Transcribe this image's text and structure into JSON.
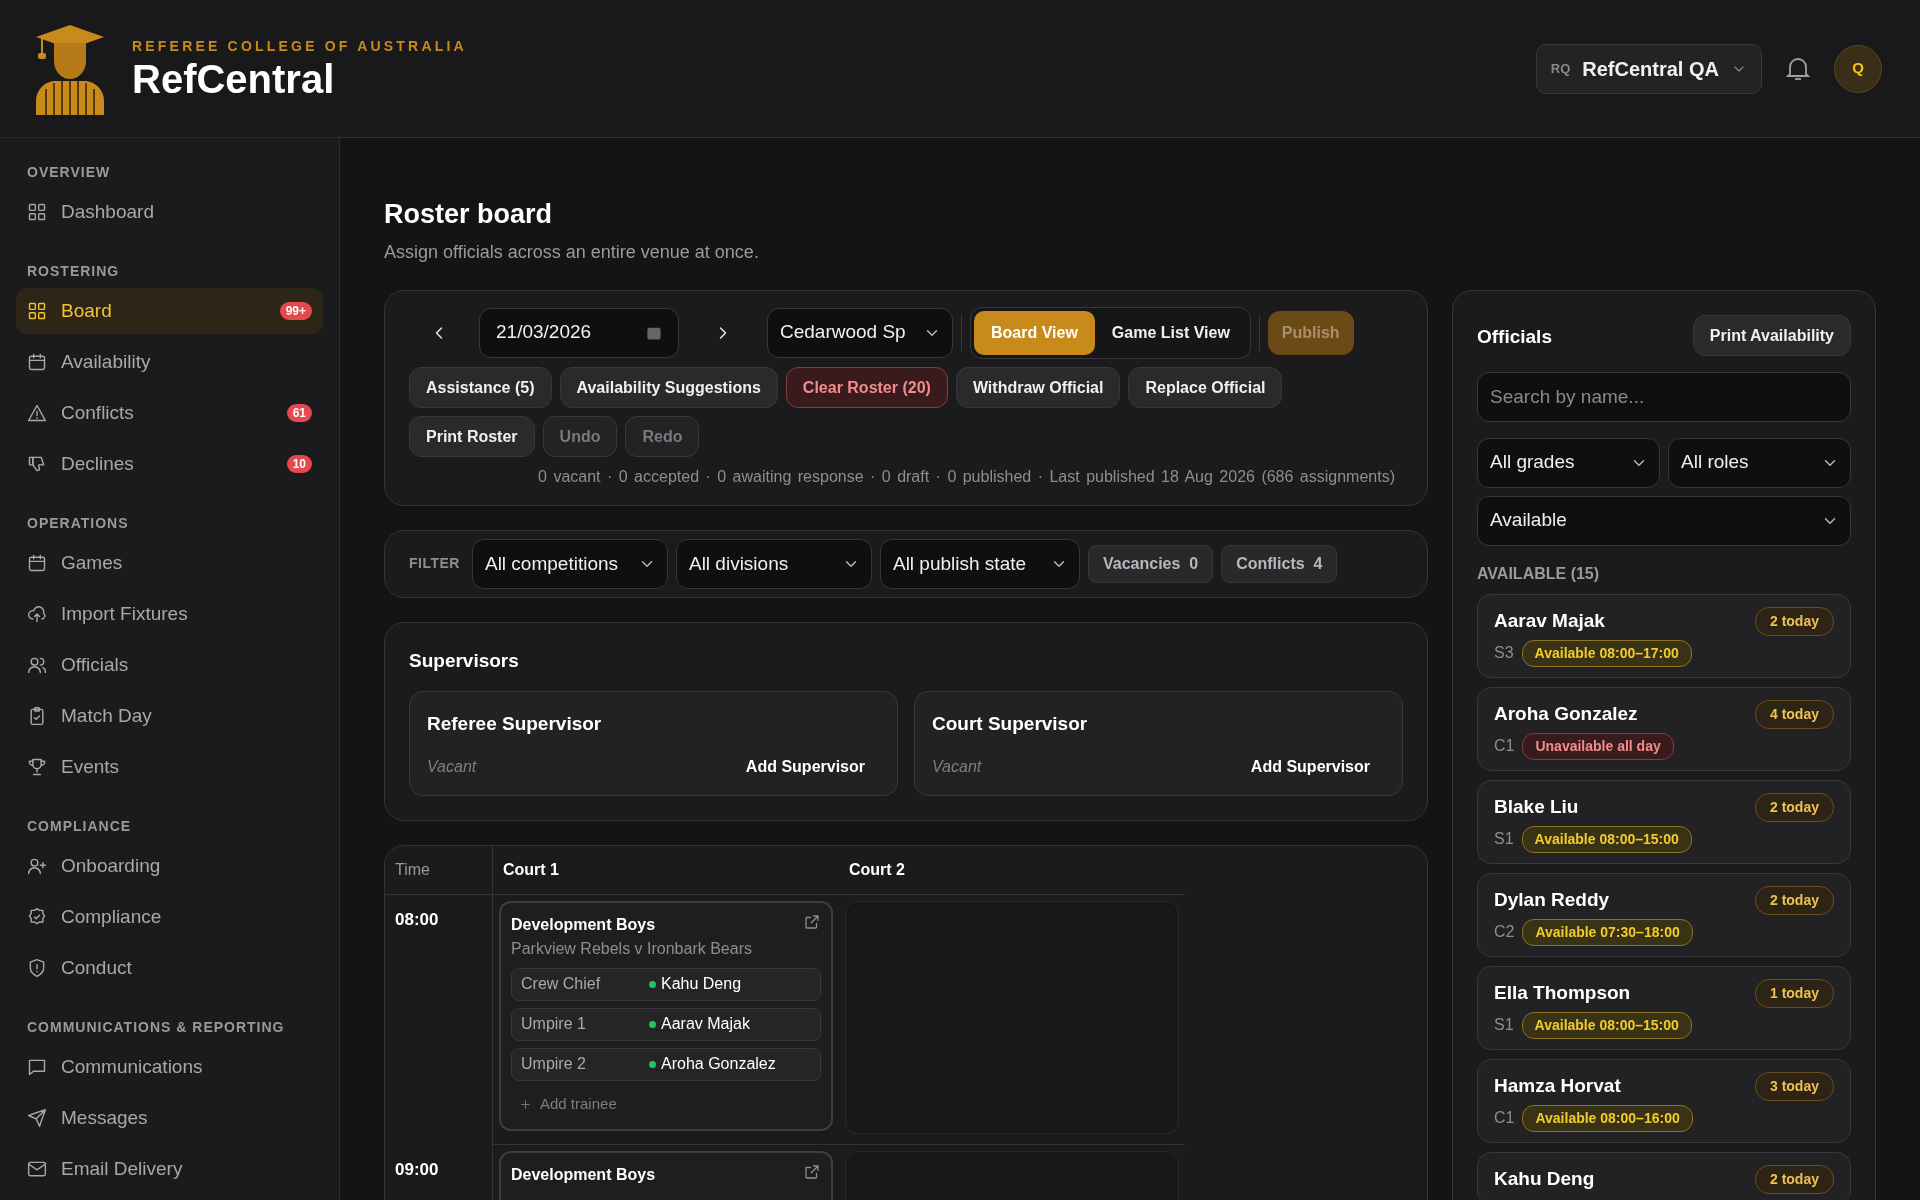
{
  "header": {
    "org": "REFEREE COLLEGE OF AUSTRALIA",
    "app": "RefCentral",
    "workspace": {
      "initials": "RQ",
      "name": "RefCentral QA"
    },
    "avatar": "Q"
  },
  "sidebar": {
    "sections": [
      {
        "title": "OVERVIEW",
        "items": [
          {
            "label": "Dashboard",
            "selected": false
          }
        ]
      },
      {
        "title": "ROSTERING",
        "items": [
          {
            "label": "Board",
            "selected": true,
            "badge": "99+"
          },
          {
            "label": "Availability",
            "selected": false
          },
          {
            "label": "Conflicts",
            "selected": false,
            "badge": "61"
          },
          {
            "label": "Declines",
            "selected": false,
            "badge": "10"
          }
        ]
      },
      {
        "title": "OPERATIONS",
        "items": [
          {
            "label": "Games",
            "selected": false
          },
          {
            "label": "Import Fixtures",
            "selected": false
          },
          {
            "label": "Officials",
            "selected": false
          },
          {
            "label": "Match Day",
            "selected": false
          },
          {
            "label": "Events",
            "selected": false
          }
        ]
      },
      {
        "title": "COMPLIANCE",
        "items": [
          {
            "label": "Onboarding",
            "selected": false
          },
          {
            "label": "Compliance",
            "selected": false
          },
          {
            "label": "Conduct",
            "selected": false
          }
        ]
      },
      {
        "title": "COMMUNICATIONS & REPORTING",
        "items": [
          {
            "label": "Communications",
            "selected": false
          },
          {
            "label": "Messages",
            "selected": false
          },
          {
            "label": "Email Delivery",
            "selected": false
          }
        ]
      }
    ]
  },
  "page": {
    "title": "Roster board",
    "subtitle": "Assign officials across an entire venue at once."
  },
  "toolbar": {
    "date": "21/03/2026",
    "venue": "Cedarwood Sp",
    "views": [
      {
        "label": "Board View",
        "selected": true
      },
      {
        "label": "Game List View",
        "selected": false
      }
    ],
    "publish": {
      "label": "Publish",
      "disabled": true
    },
    "actions": [
      {
        "label": "Assistance (5)",
        "kind": "default"
      },
      {
        "label": "Availability Suggestions",
        "kind": "default"
      },
      {
        "label": "Clear Roster (20)",
        "kind": "danger"
      },
      {
        "label": "Withdraw Official",
        "kind": "default"
      },
      {
        "label": "Replace Official",
        "kind": "default"
      },
      {
        "label": "Print Roster",
        "kind": "default"
      },
      {
        "label": "Undo",
        "kind": "disabled"
      },
      {
        "label": "Redo",
        "kind": "disabled"
      }
    ],
    "summary": "0 vacant · 0 accepted · 0 awaiting response · 0 draft · 0 published · Last published 18 Aug 2026 (686 assignments)"
  },
  "filter": {
    "label": "FILTER",
    "selects": [
      "All competitions",
      "All divisions",
      "All publish state"
    ],
    "chips": [
      {
        "label": "Vacancies",
        "count": "0"
      },
      {
        "label": "Conflicts",
        "count": "4"
      }
    ]
  },
  "supervisors": {
    "title": "Supervisors",
    "cards": [
      {
        "role": "Referee Supervisor",
        "status": "Vacant",
        "action": "Add Supervisor"
      },
      {
        "role": "Court Supervisor",
        "status": "Vacant",
        "action": "Add Supervisor"
      }
    ]
  },
  "board": {
    "columns": [
      "Time",
      "Court 1",
      "Court 2"
    ],
    "slots": [
      {
        "time": "08:00",
        "games": [
          {
            "division": "Development Boys",
            "teams": "Parkview Rebels v Ironbark Bears",
            "roles": [
              {
                "role": "Crew Chief",
                "official": "Kahu Deng",
                "color": "#22c55e"
              },
              {
                "role": "Umpire 1",
                "official": "Aarav Majak",
                "color": "#22c55e"
              },
              {
                "role": "Umpire 2",
                "official": "Aroha Gonzalez",
                "color": "#22c55e"
              }
            ],
            "add": "Add trainee",
            "kind": "game"
          },
          {
            "kind": "empty"
          }
        ]
      },
      {
        "time": "09:00",
        "games": [
          {
            "division": "Development Boys",
            "kind": "game"
          },
          {
            "kind": "empty"
          }
        ]
      }
    ]
  },
  "officials": {
    "title": "Officials",
    "print": "Print Availability",
    "search": {
      "placeholder": "Search by name..."
    },
    "selects": [
      "All grades",
      "All roles",
      "Available"
    ],
    "heading": "AVAILABLE (15)",
    "items": [
      {
        "name": "Aarav Majak",
        "grade": "S3",
        "load": "2 today",
        "availability": "Available 08:00–17:00",
        "available": true
      },
      {
        "name": "Aroha Gonzalez",
        "grade": "C1",
        "load": "4 today",
        "availability": "Unavailable all day",
        "available": false
      },
      {
        "name": "Blake Liu",
        "grade": "S1",
        "load": "2 today",
        "availability": "Available 08:00–15:00",
        "available": true
      },
      {
        "name": "Dylan Reddy",
        "grade": "C2",
        "load": "2 today",
        "availability": "Available 07:30–18:00",
        "available": true
      },
      {
        "name": "Ella Thompson",
        "grade": "S1",
        "load": "1 today",
        "availability": "Available 08:00–15:00",
        "available": true
      },
      {
        "name": "Hamza Horvat",
        "grade": "C1",
        "load": "3 today",
        "availability": "Available 08:00–16:00",
        "available": true
      },
      {
        "name": "Kahu Deng",
        "load": "2 today"
      }
    ]
  }
}
